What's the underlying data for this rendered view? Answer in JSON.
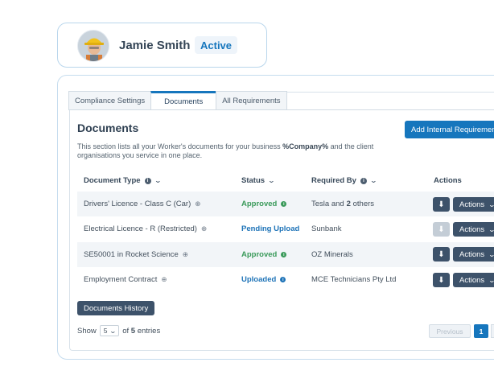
{
  "worker": {
    "name": "Jamie Smith",
    "status": "Active"
  },
  "tabs": [
    {
      "label": "Compliance Settings",
      "active": false
    },
    {
      "label": "Documents",
      "active": true
    },
    {
      "label": "All Requirements",
      "active": false
    }
  ],
  "section": {
    "title": "Documents",
    "add_button": "Add Internal Requirement",
    "description_parts": [
      "This section lists all your Worker's documents for your business ",
      "%Company%",
      " and the client organisations you service in one place."
    ]
  },
  "table": {
    "headers": {
      "document_type": "Document Type",
      "status": "Status",
      "required_by": "Required By",
      "actions": "Actions"
    },
    "rows": [
      {
        "document": "Drivers' Licence - Class C (Car)",
        "status": "Approved",
        "required_by_prefix": "Tesla and ",
        "required_by_count": "2",
        "required_by_suffix": " others",
        "download_enabled": true,
        "actions_label": "Actions"
      },
      {
        "document": "Electrical Licence - R (Restricted)",
        "status": "Pending Upload",
        "required_by_prefix": "Sunbank",
        "required_by_count": "",
        "required_by_suffix": "",
        "download_enabled": false,
        "actions_label": "Actions"
      },
      {
        "document": "SE50001 in Rocket Science",
        "status": "Approved",
        "required_by_prefix": "OZ Minerals",
        "required_by_count": "",
        "required_by_suffix": "",
        "download_enabled": true,
        "actions_label": "Actions"
      },
      {
        "document": "Employment Contract",
        "status": "Uploaded",
        "required_by_prefix": "MCE Technicians Pty Ltd",
        "required_by_count": "",
        "required_by_suffix": "",
        "download_enabled": true,
        "actions_label": "Actions"
      }
    ]
  },
  "history_button": "Documents History",
  "pagination": {
    "show_label": "Show",
    "page_size": "5",
    "entries_prefix": "of ",
    "entries_count": "5",
    "entries_suffix": " entries",
    "previous_label": "Previous",
    "current_page": "1"
  },
  "colors": {
    "primary": "#1676bd",
    "dark_button": "#3d526a",
    "approved": "#3a9a5a"
  }
}
